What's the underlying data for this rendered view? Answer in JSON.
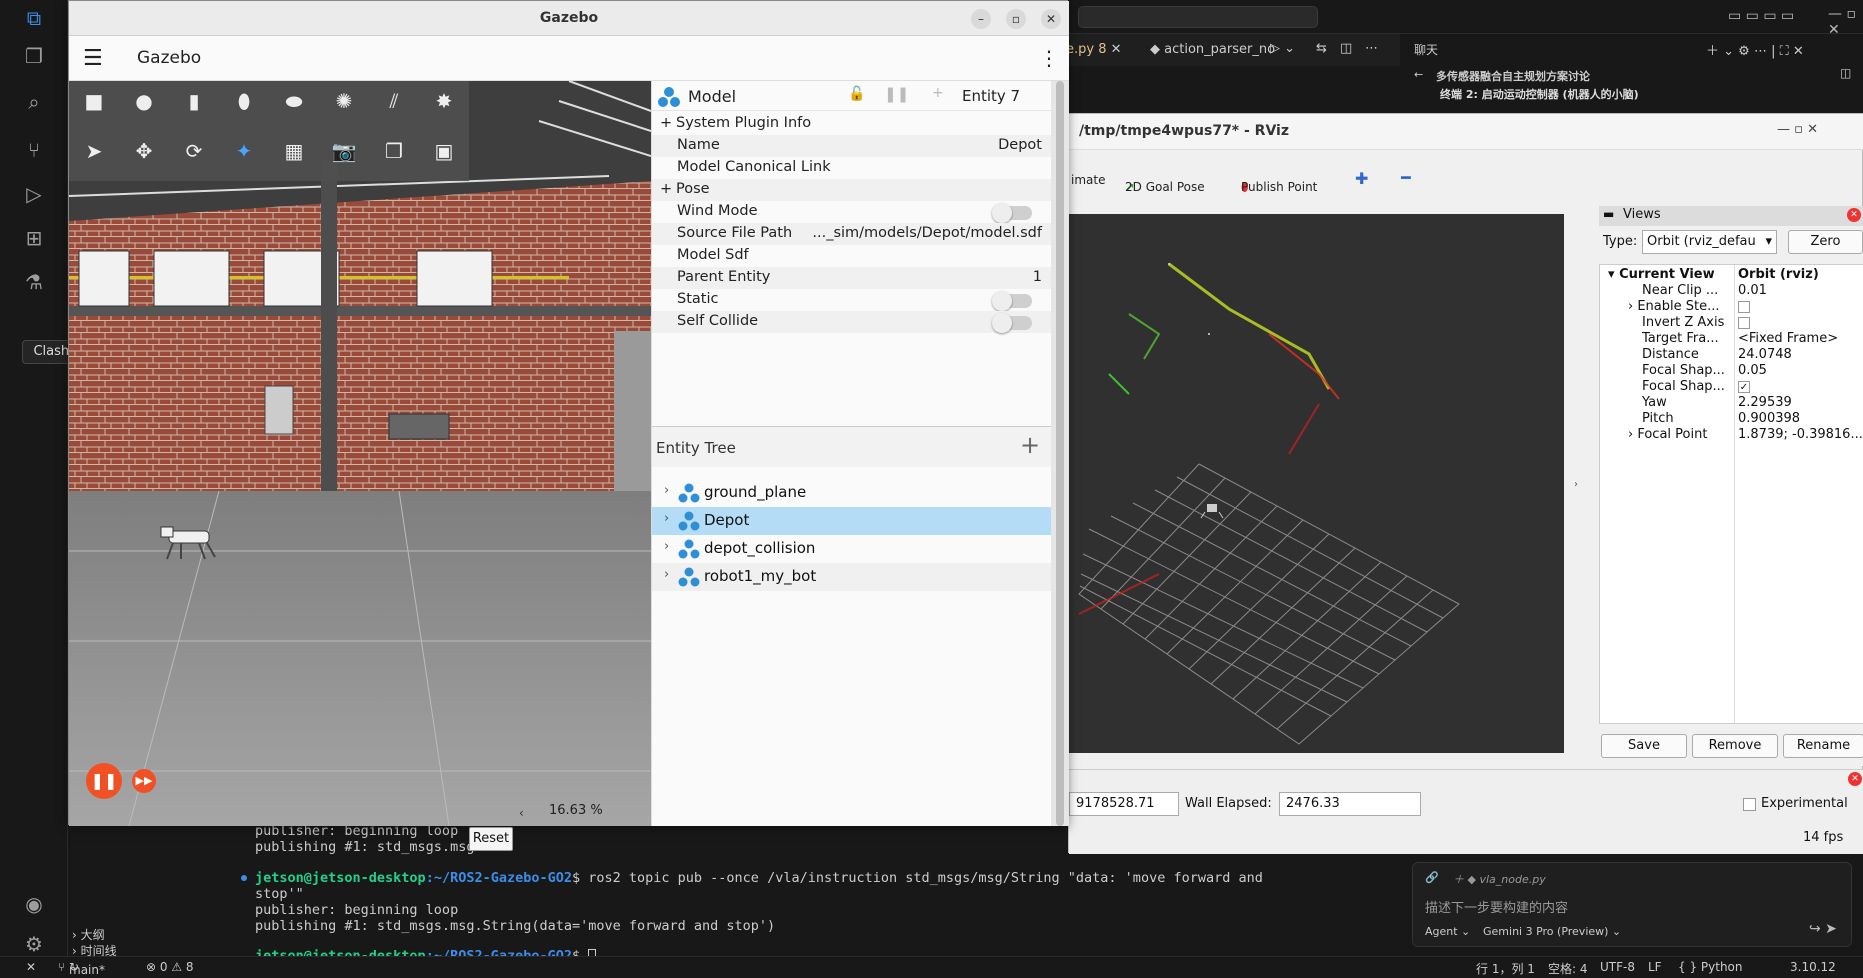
{
  "vscode": {
    "tabs": [
      {
        "label": "e.py 8"
      },
      {
        "label": "action_parser_no"
      }
    ],
    "chat": {
      "header": "聊天",
      "thread_title": "多传感器融合自主规划方案讨论",
      "subtitle": "终端 2: 启动运动控制器 (机器人的小脑)",
      "input_file": "vla_node.py",
      "input_placeholder": "描述下一步要构建的内容",
      "agent_label": "Agent",
      "model_label": "Gemini 3 Pro (Preview)"
    },
    "tooltip": "Clash Verge",
    "terminal": {
      "lines_top": [
        "publisher: beginning loop",
        "publishing #1: std_msgs.msg."
      ],
      "prompt_user": "jetson@jetson-desktop",
      "prompt_path": ":~/ROS2-Gazebo-GO2",
      "command": "$ ros2 topic pub --once /vla/instruction std_msgs/msg/String \"data: 'move forward and",
      "command_cont": "stop'\"",
      "out1": "publisher: beginning loop",
      "out2": "publishing #1: std_msgs.msg.String(data='move forward and stop')",
      "prompt2_suffix": "$"
    },
    "outline": [
      "大纲",
      "时间线"
    ],
    "status": {
      "branch": "main*",
      "problems": "⊗ 0 ⚠ 8",
      "position": "行 1，列 1",
      "spaces": "空格: 4",
      "encoding": "UTF-8",
      "eol": "LF",
      "language": "{ } Python",
      "version": "3.10.12"
    }
  },
  "rviz": {
    "title": "/tmp/tmpe4wpus77* - RViz",
    "toolbar": {
      "estimate": "imate",
      "goal": "2D Goal Pose",
      "publish": "Publish Point"
    },
    "views": {
      "header": "Views",
      "type_label": "Type:",
      "type_value": "Orbit (rviz_defau",
      "zero": "Zero",
      "current_view": "Current View",
      "current_view_value": "Orbit (rviz)",
      "props": [
        {
          "k": "Near Clip ...",
          "v": "0.01"
        },
        {
          "k": "Enable Ste...",
          "v": ""
        },
        {
          "k": "Invert Z Axis",
          "v": ""
        },
        {
          "k": "Target Fra...",
          "v": "<Fixed Frame>"
        },
        {
          "k": "Distance",
          "v": "24.0748"
        },
        {
          "k": "Focal Shap...",
          "v": "0.05"
        },
        {
          "k": "Focal Shap...",
          "v": "✓"
        },
        {
          "k": "Yaw",
          "v": "2.29539"
        },
        {
          "k": "Pitch",
          "v": "0.900398"
        },
        {
          "k": "Focal Point",
          "v": "1.8739; -0.39816..."
        }
      ],
      "save": "Save",
      "remove": "Remove",
      "rename": "Rename"
    },
    "time": {
      "ros_elapsed": "9178528.71",
      "wall_label": "Wall Elapsed:",
      "wall_value": "2476.33",
      "experimental": "Experimental",
      "fps": "14 fps"
    }
  },
  "gazebo": {
    "window_title": "Gazebo",
    "app_title": "Gazebo",
    "scene": {
      "zoom": "16.63 %",
      "reset": "Reset"
    },
    "component": {
      "title": "Model",
      "entity": "Entity 7",
      "rows": [
        {
          "k": "System Plugin Info",
          "v": "",
          "expand": true
        },
        {
          "k": "Name",
          "v": "Depot"
        },
        {
          "k": "Model Canonical Link",
          "v": ""
        },
        {
          "k": "Pose",
          "v": "",
          "expand": true
        },
        {
          "k": "Wind Mode",
          "v": "",
          "toggle": true
        },
        {
          "k": "Source File Path",
          "v": "..._sim/models/Depot/model.sdf"
        },
        {
          "k": "Model Sdf",
          "v": ""
        },
        {
          "k": "Parent Entity",
          "v": "1"
        },
        {
          "k": "Static",
          "v": "",
          "toggle": true
        },
        {
          "k": "Self Collide",
          "v": "",
          "toggle": true
        }
      ]
    },
    "tree": {
      "title": "Entity Tree",
      "items": [
        {
          "label": "ground_plane",
          "selected": false
        },
        {
          "label": "Depot",
          "selected": true
        },
        {
          "label": "depot_collision",
          "selected": false
        },
        {
          "label": "robot1_my_bot",
          "selected": false
        }
      ]
    }
  },
  "colors": {
    "selection": "#b5dcf7",
    "play_button": "#f05023",
    "rviz_bg": "#303030"
  }
}
